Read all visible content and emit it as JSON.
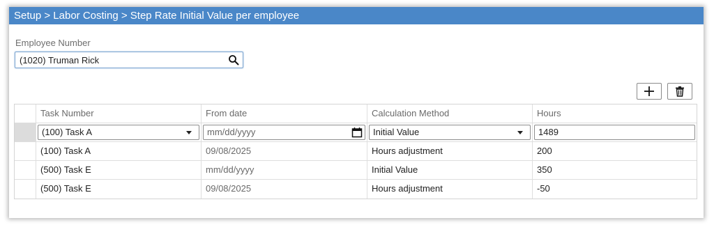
{
  "breadcrumb": "Setup > Labor Costing > Step Rate Initial Value per employee",
  "employee": {
    "label": "Employee Number",
    "value": "(1020) Truman Rick"
  },
  "toolbar": {
    "add_icon": "plus-icon",
    "delete_icon": "trash-icon"
  },
  "grid": {
    "columns": [
      "Task Number",
      "From date",
      "Calculation Method",
      "Hours"
    ],
    "edit_row": {
      "task": "(100) Task A",
      "from_date_placeholder": "mm/dd/yyyy",
      "method": "Initial Value",
      "hours": "1489"
    },
    "rows": [
      {
        "task": "(100) Task A",
        "from_date": "09/08/2025",
        "method": "Hours adjustment",
        "hours": "200"
      },
      {
        "task": "(500) Task E",
        "from_date": "mm/dd/yyyy",
        "method": "Initial Value",
        "hours": "350"
      },
      {
        "task": "(500) Task E",
        "from_date": "09/08/2025",
        "method": "Hours adjustment",
        "hours": "-50"
      }
    ]
  },
  "colors": {
    "titlebar": "#4a87c8",
    "border": "#d4d4d4"
  }
}
